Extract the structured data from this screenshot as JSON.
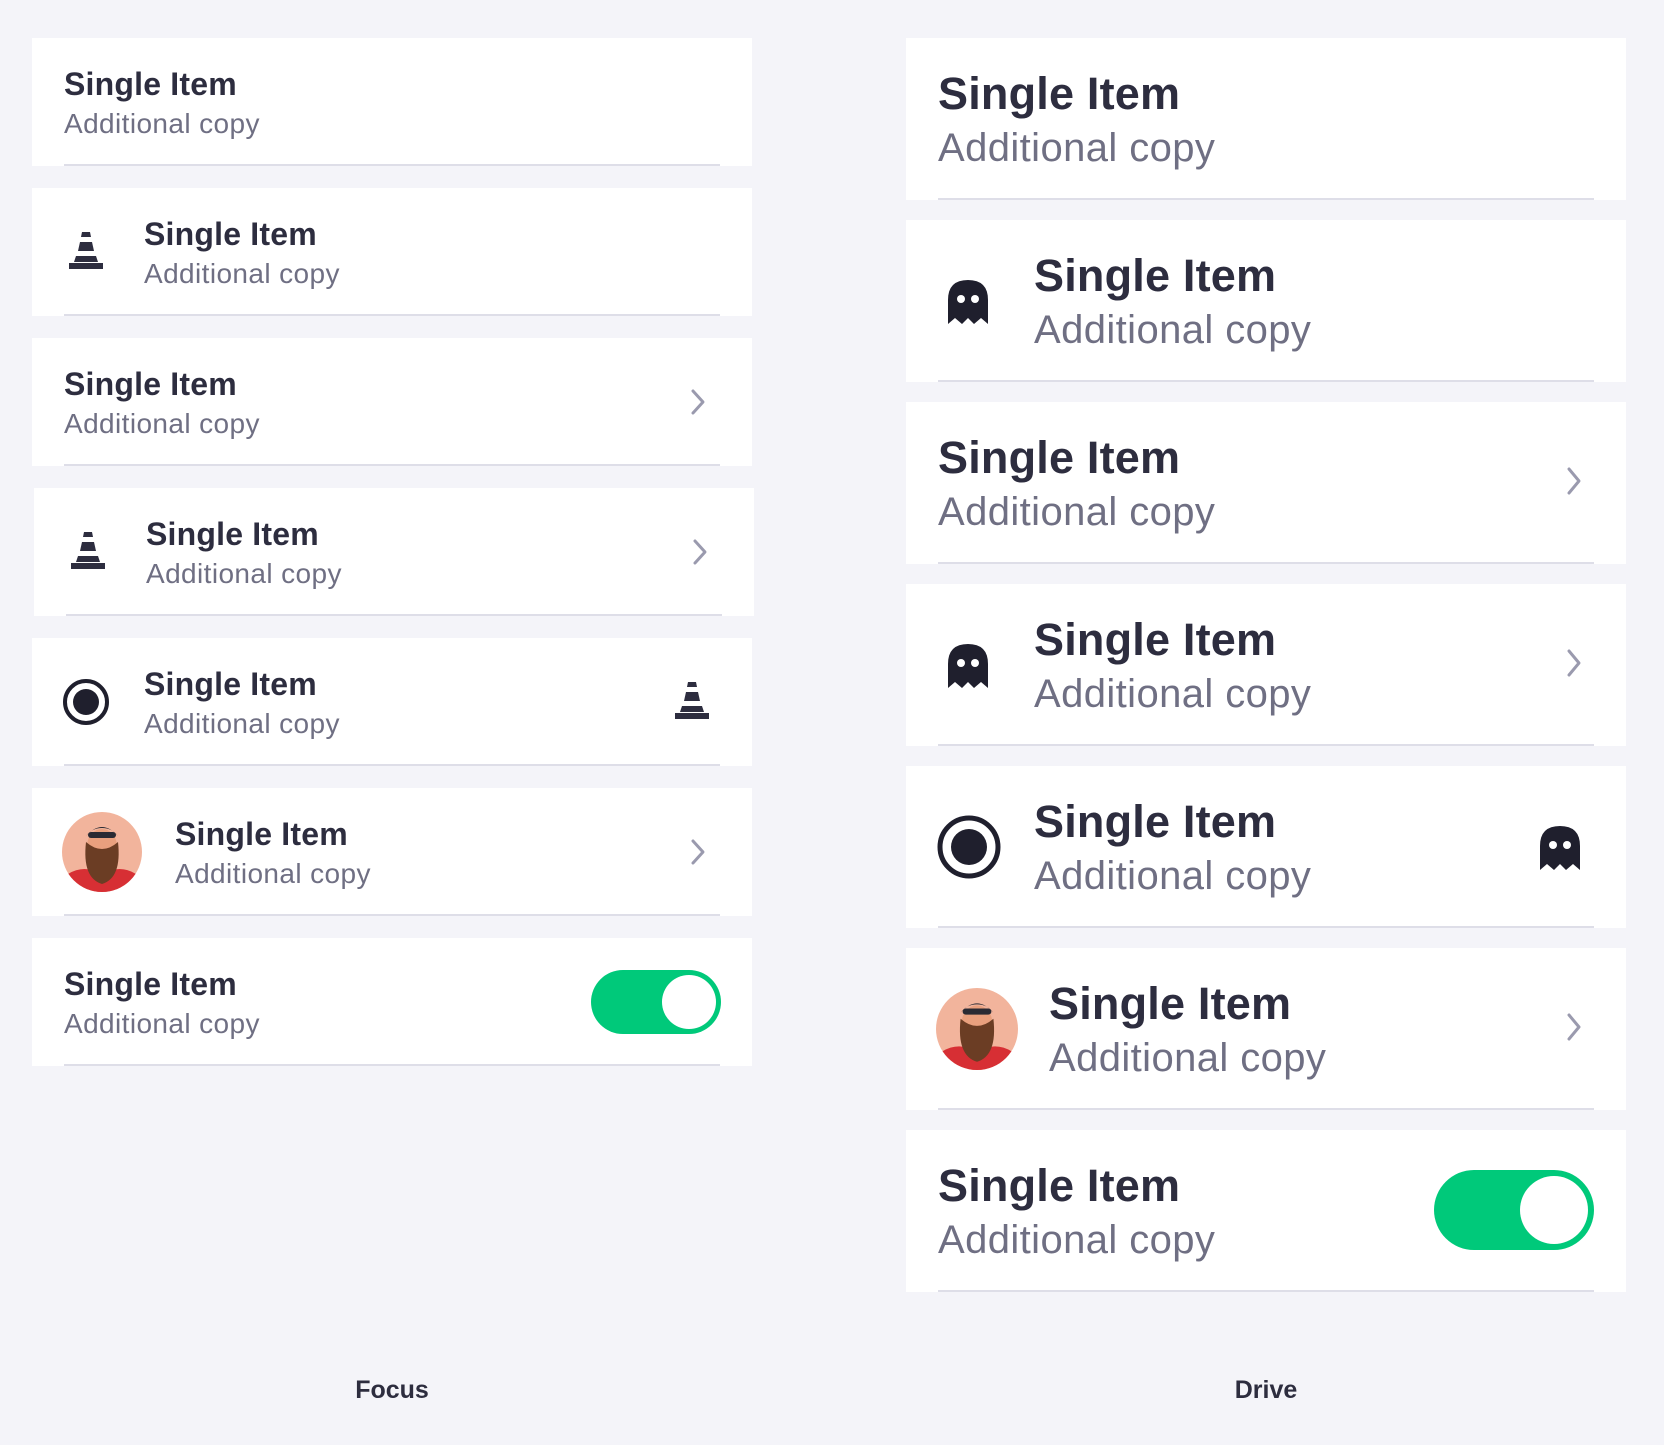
{
  "colors": {
    "background": "#f4f4f9",
    "card": "#ffffff",
    "title": "#2d2d3f",
    "subtitle": "#6f6f83",
    "divider": "#dedee8",
    "chevron": "#9a9aae",
    "toggle_on": "#00c97a"
  },
  "focus": {
    "caption": "Focus",
    "items": [
      {
        "title": "Single Item",
        "subtitle": "Additional copy"
      },
      {
        "title": "Single Item",
        "subtitle": "Additional copy",
        "leading_icon": "traffic-cone-icon"
      },
      {
        "title": "Single Item",
        "subtitle": "Additional copy",
        "trailing_icon": "chevron-right-icon"
      },
      {
        "title": "Single Item",
        "subtitle": "Additional copy",
        "leading_icon": "traffic-cone-icon",
        "trailing_icon": "chevron-right-icon"
      },
      {
        "title": "Single Item",
        "subtitle": "Additional copy",
        "leading_icon": "radio-selected-icon",
        "trailing_icon": "traffic-cone-icon"
      },
      {
        "title": "Single Item",
        "subtitle": "Additional copy",
        "leading_icon": "avatar",
        "trailing_icon": "chevron-right-icon"
      },
      {
        "title": "Single Item",
        "subtitle": "Additional copy",
        "toggle": true
      }
    ]
  },
  "drive": {
    "caption": "Drive",
    "items": [
      {
        "title": "Single Item",
        "subtitle": "Additional copy"
      },
      {
        "title": "Single Item",
        "subtitle": "Additional copy",
        "leading_icon": "ghost-icon"
      },
      {
        "title": "Single Item",
        "subtitle": "Additional copy",
        "trailing_icon": "chevron-right-icon"
      },
      {
        "title": "Single Item",
        "subtitle": "Additional copy",
        "leading_icon": "ghost-icon",
        "trailing_icon": "chevron-right-icon"
      },
      {
        "title": "Single Item",
        "subtitle": "Additional copy",
        "leading_icon": "radio-selected-icon",
        "trailing_icon": "ghost-icon"
      },
      {
        "title": "Single Item",
        "subtitle": "Additional copy",
        "leading_icon": "avatar",
        "trailing_icon": "chevron-right-icon"
      },
      {
        "title": "Single Item",
        "subtitle": "Additional copy",
        "toggle": true
      }
    ]
  }
}
